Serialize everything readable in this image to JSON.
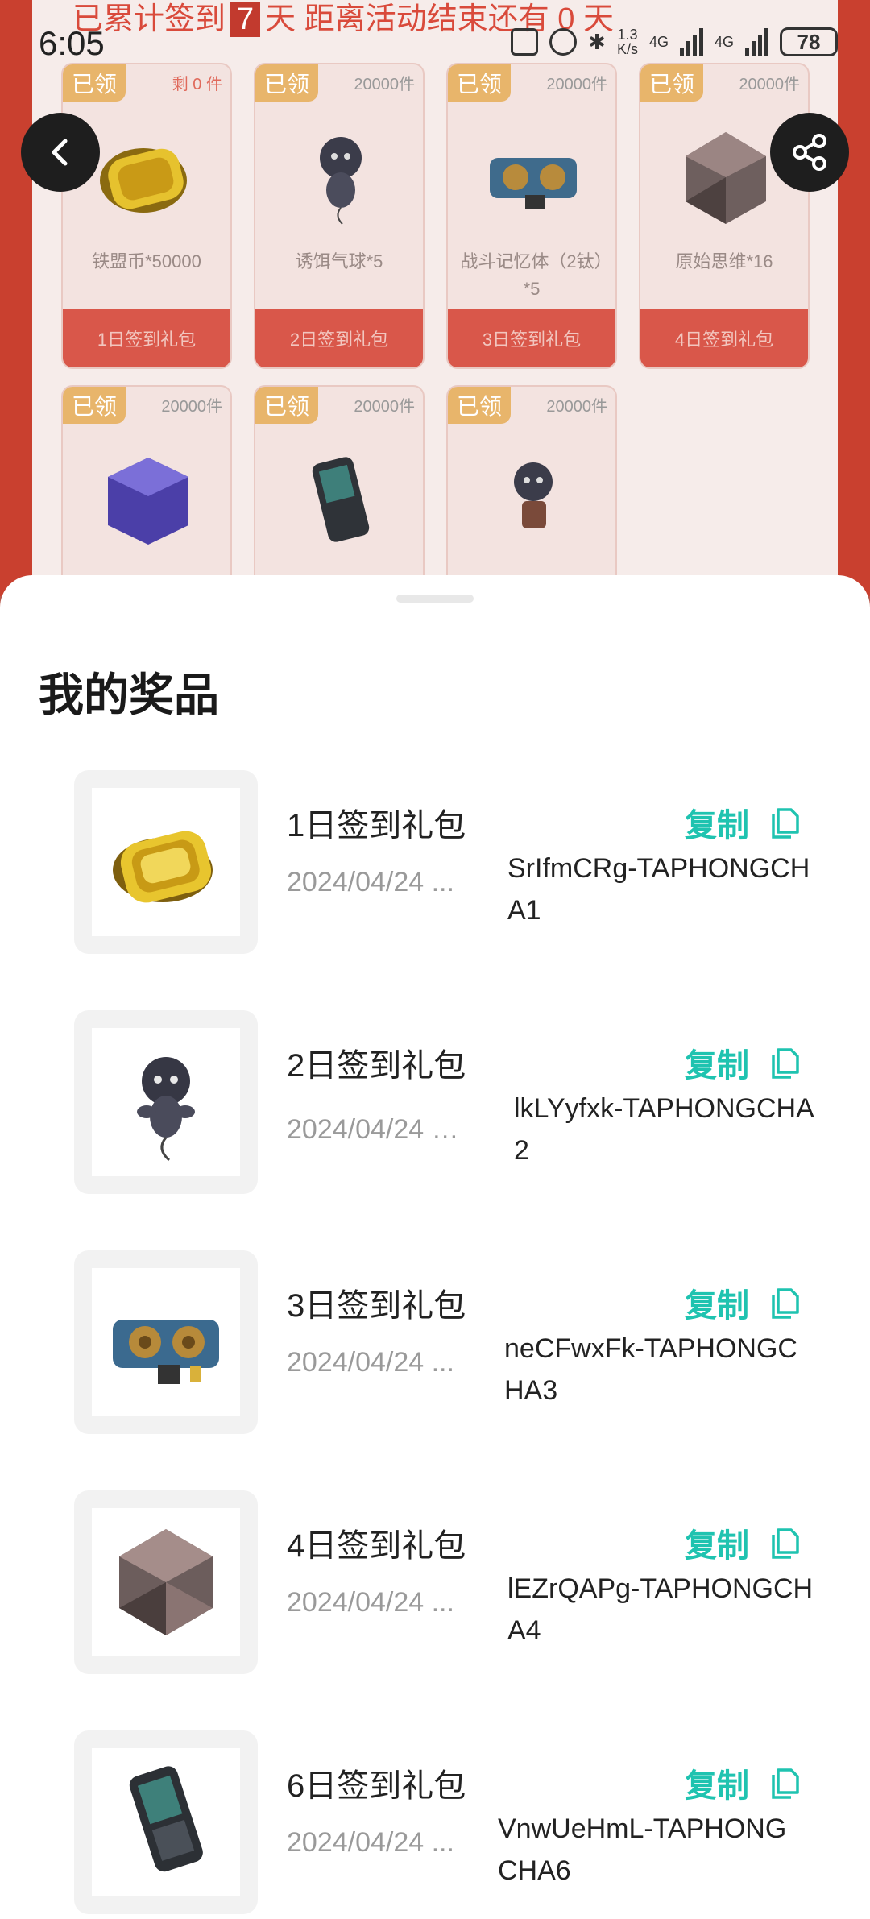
{
  "status_bar": {
    "time": "6:05",
    "speed_top": "1.3",
    "speed_unit": "K/s",
    "net1": "4G",
    "net2": "4G",
    "battery": "78"
  },
  "activity": {
    "banner_prefix": "已累计签到",
    "banner_days": "7",
    "banner_suffix": "天  距离活动结束还有 0 天",
    "claimed_label": "已领",
    "cards": [
      {
        "stock": "剩 0 件",
        "name": "铁盟币*50000",
        "ribbon": "1日签到礼包"
      },
      {
        "stock": "20000件",
        "name": "诱饵气球*5",
        "ribbon": "2日签到礼包"
      },
      {
        "stock": "20000件",
        "name": "战斗记忆体（2钛）*5",
        "ribbon": "3日签到礼包"
      },
      {
        "stock": "20000件",
        "name": "原始思维*16",
        "ribbon": "4日签到礼包"
      },
      {
        "stock": "20000件",
        "name": "",
        "ribbon": ""
      },
      {
        "stock": "20000件",
        "name": "",
        "ribbon": ""
      },
      {
        "stock": "20000件",
        "name": "",
        "ribbon": ""
      }
    ]
  },
  "sheet": {
    "title": "我的奖品",
    "copy_label": "复制",
    "prizes": [
      {
        "title": "1日签到礼包",
        "date": "2024/04/24 ...",
        "code": "SrIfmCRg-TAPHONGCHA1",
        "icon": "gold-coin-icon"
      },
      {
        "title": "2日签到礼包",
        "date": "2024/04/24 前...",
        "code": "lkLYyfxk-TAPHONGCHA2",
        "icon": "balloon-icon"
      },
      {
        "title": "3日签到礼包",
        "date": "2024/04/24 ...",
        "code": "neCFwxFk-TAPHONGCHA3",
        "icon": "memory-chip-icon"
      },
      {
        "title": "4日签到礼包",
        "date": "2024/04/24 ...",
        "code": "lEZrQAPg-TAPHONGCHA4",
        "icon": "crystal-icon"
      },
      {
        "title": "6日签到礼包",
        "date": "2024/04/24 ...",
        "code": "VnwUeHmL-TAPHONGCHA6",
        "icon": "armor-icon"
      }
    ]
  },
  "colors": {
    "accent": "#1fc3b0",
    "ribbon": "#d9574a",
    "claimed": "#e8b56b"
  }
}
